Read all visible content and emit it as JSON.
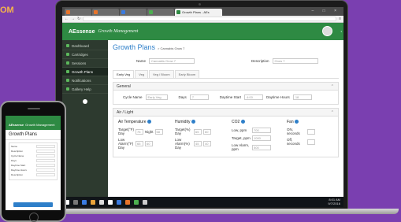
{
  "corner_brand": "OM",
  "browser": {
    "active_tab_title": "Growth Plans - AEs"
  },
  "app": {
    "logo": "AEssense",
    "tagline": "Growth Management"
  },
  "sidebar": {
    "items": [
      {
        "label": "Dashboard"
      },
      {
        "label": "Cartridges"
      },
      {
        "label": "Sessions"
      },
      {
        "label": "Growth Plans"
      },
      {
        "label": "Notifications"
      },
      {
        "label": "Gallery Help"
      }
    ]
  },
  "page": {
    "title": "Growth Plans",
    "breadcrumb": "> Cannabis Grow 7",
    "name_label": "Name",
    "name_value": "Cannabis Grow 7",
    "desc_label": "Description",
    "desc_value": "Grow 7",
    "tabs": [
      "Early Veg",
      "Veg",
      "Veg / Bloom",
      "Early Bloom"
    ],
    "general": {
      "heading": "General",
      "cycle_label": "Cycle Name",
      "cycle_value": "Early Veg",
      "days_label": "Days",
      "days_value": "7",
      "daytime_start_label": "Daytime Start",
      "daytime_start_value": "4:00",
      "daytime_hours_label": "Daytime Hours",
      "daytime_hours_value": "18"
    },
    "air_light": {
      "heading": "Air / Light",
      "air_temp": {
        "heading": "Air Temperature",
        "target_label": "Target(°F) Day",
        "target_value": "75",
        "night_label": "Night",
        "night_value": "68",
        "low_label": "Low Alarm(°F) Day",
        "low_value": "65",
        "low_night_value": "60"
      },
      "humidity": {
        "heading": "Humidity",
        "target_label": "Target(%) Day",
        "target_value": "65",
        "target_night": "60",
        "low_label": "Low Alarm(%) Day",
        "low_value": "45",
        "low_night": "40"
      },
      "co2": {
        "heading": "CO2",
        "low_label": "Low, ppm",
        "low_value": "700",
        "target_label": "Target, ppm",
        "target_value": "1000",
        "alarm_label": "Low Alarm, ppm",
        "alarm_value": "500"
      },
      "fan": {
        "heading": "Fan",
        "on_label": "ON, seconds",
        "off_label": "Off, seconds"
      }
    }
  },
  "taskbar": {
    "time": "8:01 AM",
    "date": "9/7/2016"
  },
  "phone": {
    "app_logo": "AEssense",
    "app_tagline": "Growth Management",
    "page_title": "Growth Plans",
    "rows": [
      "Name",
      "Description",
      "Cycle Name",
      "Days",
      "Daytime Start",
      "Daytime Hours",
      "Description"
    ]
  },
  "colors": {
    "background": "#7a3fb0",
    "header_green": "#2e8a43",
    "title_blue": "#2e7fc9",
    "sidebar": "#2d3a2f"
  }
}
